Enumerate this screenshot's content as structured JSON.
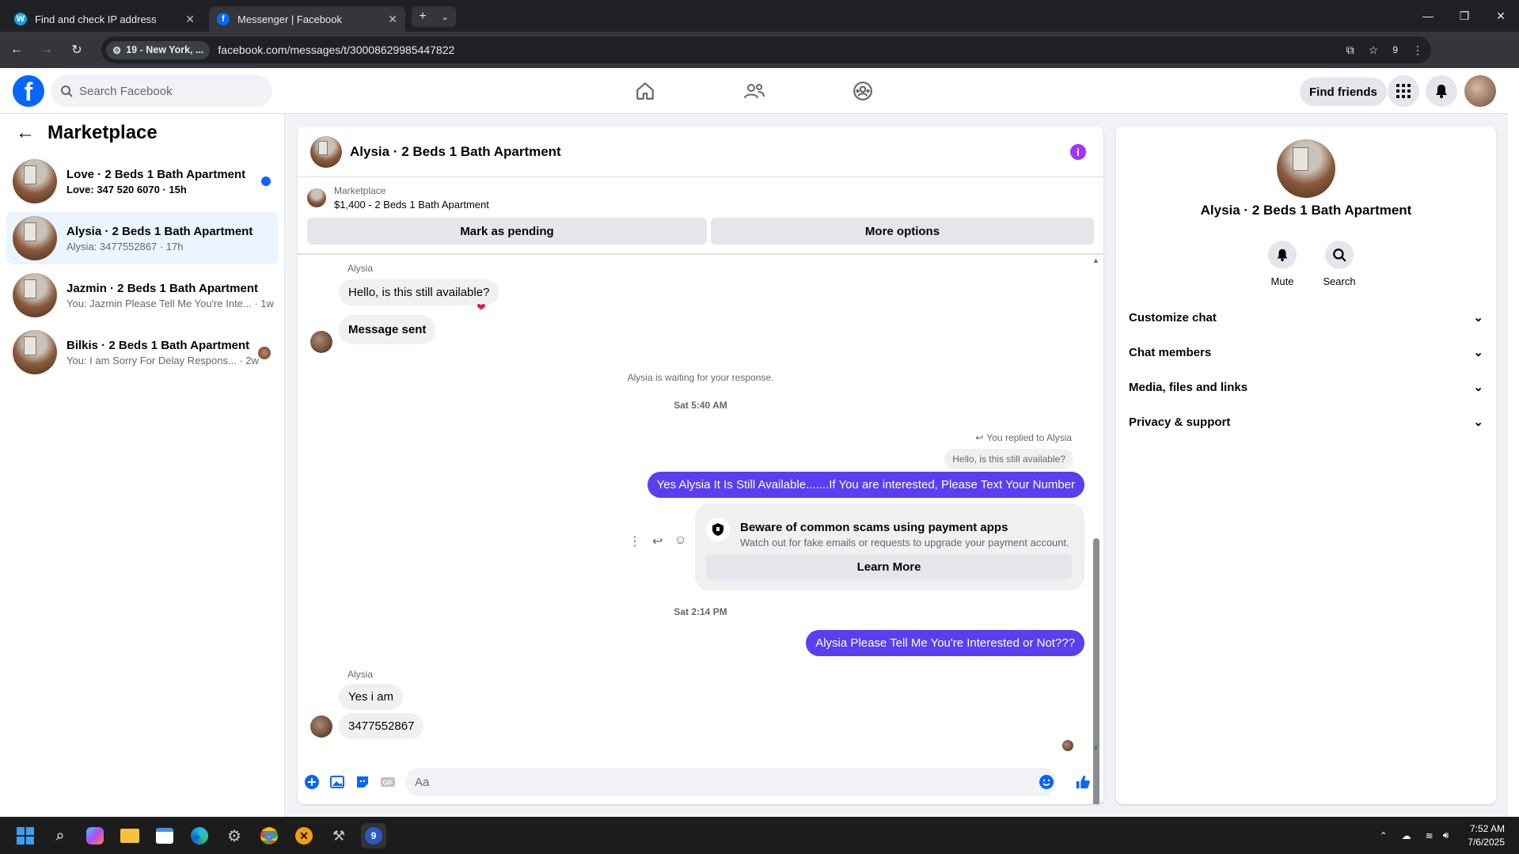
{
  "browser": {
    "tabs": [
      {
        "title": "Find and check IP address",
        "active": false
      },
      {
        "title": "Messenger | Facebook",
        "active": true
      }
    ],
    "site_chip": "19 - New York, ...",
    "url": "facebook.com/messages/t/30008629985447822",
    "extensions_count": "9"
  },
  "fb": {
    "search_placeholder": "Search Facebook",
    "find_friends": "Find friends"
  },
  "left": {
    "title": "Marketplace",
    "conversations": [
      {
        "name": "Love · 2 Beds 1 Bath Apartment",
        "preview": "Love: 347 520 6070 · 15h",
        "unread": true
      },
      {
        "name": "Alysia · 2 Beds 1 Bath Apartment",
        "preview": "Alysia: 3477552867 · 17h",
        "selected": true
      },
      {
        "name": "Jazmin · 2 Beds 1 Bath Apartment",
        "preview": "You: Jazmin Please Tell Me You're Inte... · 1w"
      },
      {
        "name": "Bilkis · 2 Beds 1 Bath Apartment",
        "preview": "You: I am Sorry For Delay Respons... · 2w"
      }
    ]
  },
  "chat": {
    "title": "Alysia · 2 Beds 1 Bath Apartment",
    "marketplace_label": "Marketplace",
    "listing": "$1,400 - 2 Beds 1 Bath Apartment",
    "mark_pending": "Mark as pending",
    "more_options": "More options",
    "sender1": "Alysia",
    "msg1": "Hello, is this still available?",
    "msg2": "Message sent",
    "waiting": "Alysia is waiting for your response.",
    "time1": "Sat 5:40 AM",
    "replied_to": "You replied to Alysia",
    "quoted": "Hello, is this still available?",
    "msg3": "Yes Alysia It Is Still Available.......If You are interested, Please Text Your Number",
    "scam_title": "Beware of common scams using payment apps",
    "scam_body": "Watch out for fake emails or requests to upgrade your payment account.",
    "learn_more": "Learn More",
    "time2": "Sat 2:14 PM",
    "msg4": "Alysia Please Tell Me You're Interested or Not???",
    "sender2": "Alysia",
    "msg5": "Yes i am",
    "msg6": "3477552867",
    "composer_placeholder": "Aa"
  },
  "right": {
    "name": "Alysia · 2 Beds 1 Bath Apartment",
    "mute": "Mute",
    "search": "Search",
    "rows": [
      "Customize chat",
      "Chat members",
      "Media, files and links",
      "Privacy & support"
    ]
  },
  "taskbar": {
    "time": "7:52 AM",
    "date": "7/6/2025"
  },
  "colors": {
    "accent": "#0866ff",
    "my_bubble": "#5a3ef0",
    "info": "#a033ff"
  }
}
